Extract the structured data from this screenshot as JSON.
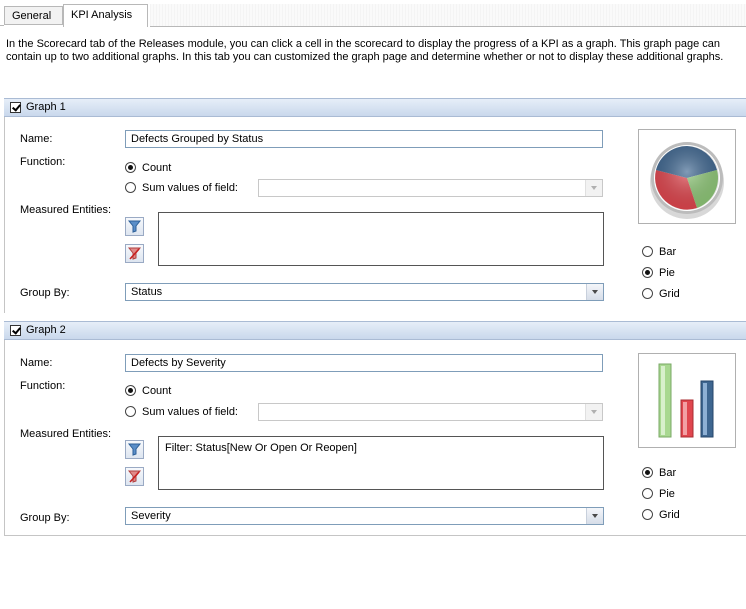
{
  "tabs": [
    {
      "label": "General"
    },
    {
      "label": "KPI Analysis"
    }
  ],
  "intro": "In the Scorecard tab of the Releases module, you can click a cell in the scorecard to display the progress of a KPI as a graph. This graph page can contain up to two additional graphs. In this tab you can customized the graph page and determine whether or not to display these additional graphs.",
  "labels": {
    "name": "Name:",
    "function": "Function:",
    "measured_entities": "Measured Entities:",
    "group_by": "Group By:",
    "count": "Count",
    "sum_values": "Sum values of field:",
    "bar": "Bar",
    "pie": "Pie",
    "grid": "Grid"
  },
  "graph1": {
    "title": "Graph 1",
    "checked": true,
    "name": "Defects Grouped  by Status",
    "function": "Count",
    "sum_field": "",
    "filter": "",
    "group_by": "Status",
    "graph_type": "Pie"
  },
  "graph2": {
    "title": "Graph 2",
    "checked": true,
    "name": "Defects by Severity",
    "function": "Count",
    "sum_field": "",
    "filter": "Filter: Status[New Or Open Or Reopen]",
    "group_by": "Severity",
    "graph_type": "Bar"
  },
  "icons": {
    "filter": "funnel-icon",
    "clear_filter": "clear-filter-icon",
    "pie_preview": "pie-chart-icon",
    "bar_preview": "bar-chart-icon"
  },
  "colors": {
    "pie_blue": "#3e6690",
    "pie_green": "#8fc878",
    "pie_red": "#e0464e",
    "bar_green": "#a8d890",
    "bar_red": "#e0464e",
    "bar_blue": "#3e6690",
    "header": "#c9d8ec"
  }
}
